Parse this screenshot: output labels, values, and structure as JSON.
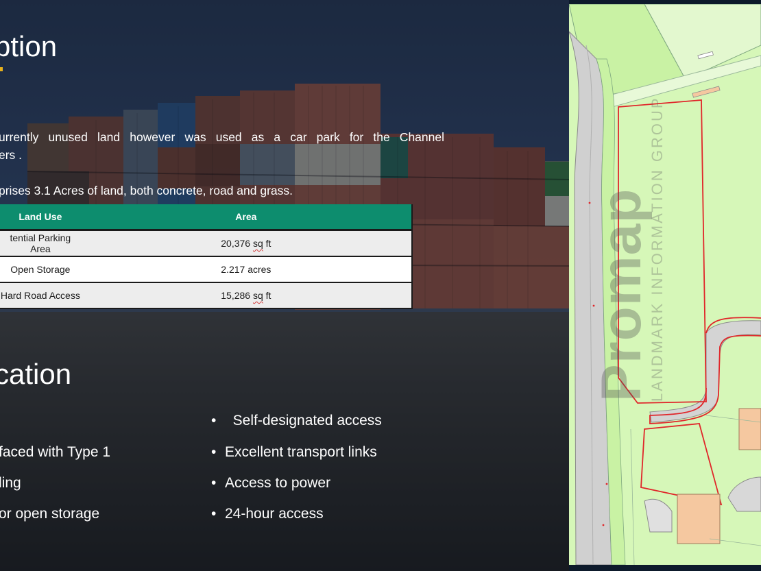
{
  "description": {
    "heading": "ption",
    "paragraph_line1": "urrently unused land however was used as a car park for the Channel",
    "paragraph_line2": "ers .",
    "paragraph2": "prises 3.1 Acres of land, both concrete, road and grass."
  },
  "table": {
    "headers": [
      "Land Use",
      "Area"
    ],
    "rows": [
      {
        "use": "tential Parking Area",
        "area_value": "20,376",
        "area_unit": "sq",
        "area_suffix": "ft"
      },
      {
        "use": "Open Storage",
        "area_value": "2.217 acres",
        "area_unit": "",
        "area_suffix": ""
      },
      {
        "use": "Hard Road Access",
        "area_value": "15,286",
        "area_unit": "sq",
        "area_suffix": "ft"
      }
    ]
  },
  "location": {
    "heading": "cation",
    "left_bullets": [
      "faced with Type 1",
      "ling",
      "or open storage"
    ],
    "right_bullets": [
      "Self-designated access",
      "Excellent transport links",
      "Access to power",
      "24-hour access"
    ],
    "bullet_glyph": "•"
  },
  "map": {
    "watermark_brand": "Promap",
    "watermark_sub": "LANDMARK INFORMATION GROUP",
    "colors": {
      "land": "#d4f7b4",
      "road": "#d2d2d2",
      "building": "#f5c8a0",
      "boundary": "#e0262a",
      "field_light": "#e6f7d3"
    }
  },
  "colors": {
    "table_header": "#0d8d6e",
    "accent": "#e8b21c",
    "text": "#ffffff"
  }
}
